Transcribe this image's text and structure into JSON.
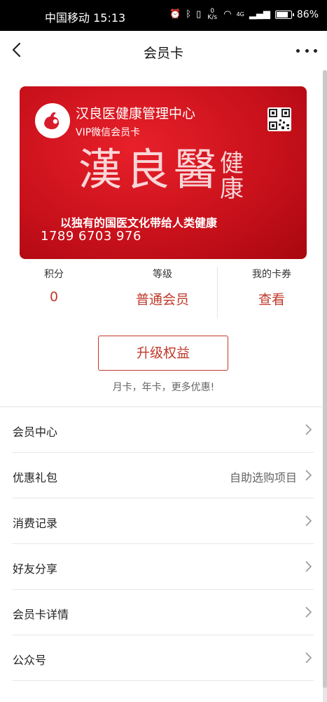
{
  "status_bar": {
    "carrier_time": "中国移动 15:13",
    "net_speed": "0 K/s",
    "network": "4G",
    "battery": "86%",
    "battery_level": 0.86,
    "icons": [
      "alarm-icon",
      "bluetooth-icon",
      "vibrate-icon",
      "wifi-icon",
      "signal-icon",
      "battery-icon"
    ]
  },
  "nav": {
    "title": "会员卡"
  },
  "card": {
    "name": "汉良医健康管理中心",
    "subtitle": "VIP微信会员卡",
    "brand_main": "漢良醫",
    "brand_side": "健康",
    "slogan": "以独有的国医文化带给人类健康",
    "number": "1789 6703 976",
    "colors": {
      "card_red": "#d41420"
    }
  },
  "stats": [
    {
      "label": "积分",
      "value": "0"
    },
    {
      "label": "等级",
      "value": "普通会员"
    },
    {
      "label": "我的卡券",
      "value": "查看"
    }
  ],
  "upgrade": {
    "button_label": "升级权益",
    "tip": "月卡，年卡，更多优惠!"
  },
  "menu": [
    {
      "label": "会员中心",
      "extra": ""
    },
    {
      "label": "优惠礼包",
      "extra": "自助选购项目"
    },
    {
      "label": "消费记录",
      "extra": ""
    },
    {
      "label": "好友分享",
      "extra": ""
    },
    {
      "label": "会员卡详情",
      "extra": ""
    },
    {
      "label": "公众号",
      "extra": ""
    }
  ],
  "accent_color": "#c0392b"
}
